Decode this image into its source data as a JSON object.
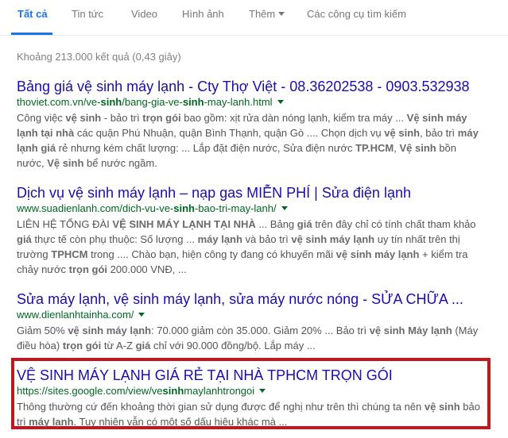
{
  "tabs": [
    {
      "label": "Tất cả",
      "active": true
    },
    {
      "label": "Tin tức",
      "active": false
    },
    {
      "label": "Video",
      "active": false
    },
    {
      "label": "Hình ảnh",
      "active": false
    },
    {
      "label": "Thêm",
      "active": false,
      "has_dropdown": true
    },
    {
      "label": "Các công cụ tìm kiếm",
      "active": false
    }
  ],
  "stats": "Khoảng 213.000 kết quả (0,43 giây)",
  "results": [
    {
      "title": "Bảng giá vệ sinh máy lạnh - Cty Thợ Việt - 08.36202538 - 0903.532938",
      "url_parts": [
        "thoviet.com.vn/ve-",
        "sinh",
        "/bang-gia-ve-",
        "sinh",
        "-may-lanh.html"
      ],
      "snippet_lines": [
        [
          [
            "Công việc ",
            false
          ],
          [
            "vệ sinh",
            true
          ],
          [
            " - bảo trì ",
            false
          ],
          [
            "trọn gói",
            true
          ],
          [
            " bao gồm: xịt rửa dàn nóng lạnh, kiểm tra máy ... ",
            false
          ],
          [
            "Vệ sinh máy",
            true
          ]
        ],
        [
          [
            "lạnh tại nhà",
            true
          ],
          [
            " các quận Phú Nhuận, quận Bình Thạnh, quận Gò .... Chọn dịch vụ ",
            false
          ],
          [
            "vệ sinh",
            true
          ],
          [
            ", bảo trì ",
            false
          ],
          [
            "máy",
            true
          ]
        ],
        [
          [
            "lạnh giá",
            true
          ],
          [
            " rẻ nhưng kém chất lượng: ... Lắp đặt điện nước, Sửa điện nước ",
            false
          ],
          [
            "TP.HCM",
            true
          ],
          [
            ", ",
            false
          ],
          [
            "Vệ sinh",
            true
          ],
          [
            " bồn",
            false
          ]
        ],
        [
          [
            "nước, ",
            false
          ],
          [
            "Vệ sinh",
            true
          ],
          [
            " bể nước ngầm.",
            false
          ]
        ]
      ]
    },
    {
      "title": "Dịch vụ vệ sinh máy lạnh – nạp gas MIỄN PHÍ | Sửa điện lạnh",
      "url_parts": [
        "www.suadienlanh.com/dich-vu-ve-",
        "sinh",
        "-bao-tri-may-lanh/",
        "",
        ""
      ],
      "snippet_lines": [
        [
          [
            "LIÊN HỆ TỔNG ĐÀI ",
            false
          ],
          [
            "VỆ SINH MÁY LẠNH TẠI NHÀ",
            true
          ],
          [
            " ... Bảng ",
            false
          ],
          [
            "giá",
            true
          ],
          [
            " trên đây chỉ có tính chất tham khảo",
            false
          ]
        ],
        [
          [
            "giá",
            true
          ],
          [
            " thực tế còn phụ thuộc: Số lượng ... ",
            false
          ],
          [
            "máy lạnh",
            true
          ],
          [
            " và bảo trì ",
            false
          ],
          [
            "vệ sinh máy lạnh",
            true
          ],
          [
            " uy tín nhất trên thị",
            false
          ]
        ],
        [
          [
            "trường ",
            false
          ],
          [
            "TPHCM",
            true
          ],
          [
            " trong .... Chào bạn, hiện công ty đang có khuyến mãi ",
            false
          ],
          [
            "vệ sinh máy lạnh",
            true
          ],
          [
            " + kiểm tra",
            false
          ]
        ],
        [
          [
            "chảy nước ",
            false
          ],
          [
            "trọn gói",
            true
          ],
          [
            " 200.000 VNĐ, ...",
            false
          ]
        ]
      ]
    },
    {
      "title": "Sửa máy lạnh, vệ sinh máy lạnh, sửa máy nước nóng - SỬA CHỮA ...",
      "url_parts": [
        "www.dienlanhtainha.com/",
        "",
        "",
        "",
        ""
      ],
      "snippet_lines": [
        [
          [
            "Giảm 50% ",
            false
          ],
          [
            "vệ sinh máy lạnh",
            true
          ],
          [
            ": 70.000 giảm còn 35.000. Giảm 20% ... Bảo trì ",
            false
          ],
          [
            "vệ sinh Máy lạnh",
            true
          ],
          [
            " (Máy",
            false
          ]
        ],
        [
          [
            "điều hòa) ",
            false
          ],
          [
            "trọn gói",
            true
          ],
          [
            " từ A-Z ",
            false
          ],
          [
            "giá",
            true
          ],
          [
            " chỉ với 90.000 đồng/bộ. Lắp máy ...",
            false
          ]
        ]
      ]
    },
    {
      "title": "VỆ SINH MÁY LẠNH GIÁ RẺ TẠI NHÀ TPHCM TRỌN GÓI",
      "url_parts": [
        "https://sites.google.com/view/ve",
        "sinh",
        "maylanhtrongoi",
        "",
        ""
      ],
      "snippet_lines": [
        [
          [
            "Thông thường cứ đến khoảng thời gian sử dụng được để nghị như trên thì chúng ta nên ",
            false
          ],
          [
            "vệ sinh",
            true
          ],
          [
            " bảo",
            false
          ]
        ],
        [
          [
            "trì ",
            false
          ],
          [
            "máy lạnh",
            true
          ],
          [
            ". Tuy nhiên vẫn có một số dấu hiệu khác mà ...",
            false
          ]
        ]
      ]
    }
  ],
  "colors": {
    "link": "#1a0dab",
    "url": "#006621",
    "active_tab": "#1a73e8",
    "highlight_border": "#c4161c"
  }
}
